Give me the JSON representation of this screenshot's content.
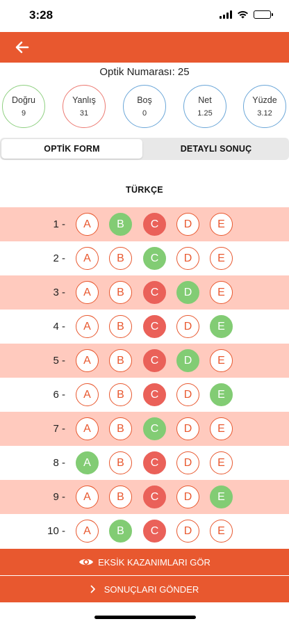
{
  "status_bar": {
    "time": "3:28"
  },
  "header": {
    "back_icon": "arrow-left-icon"
  },
  "optik": {
    "label": "Optik Numarası: 25"
  },
  "stats": [
    {
      "key": "dogru",
      "label": "Doğru",
      "value": "9",
      "color": "#8fd081"
    },
    {
      "key": "yanlis",
      "label": "Yanlış",
      "value": "31",
      "color": "#ec7a72"
    },
    {
      "key": "bos",
      "label": "Boş",
      "value": "0",
      "color": "#6aa6d8"
    },
    {
      "key": "net",
      "label": "Net",
      "value": "1.25",
      "color": "#6aa6d8"
    },
    {
      "key": "yuzde",
      "label": "Yüzde",
      "value": "3.12",
      "color": "#6aa6d8"
    }
  ],
  "tabs": {
    "optik_form": "OPTİK FORM",
    "detayli_sonuc": "DETAYLI SONUÇ",
    "active": "optik_form"
  },
  "section": {
    "title": "TÜRKÇE"
  },
  "options": [
    "A",
    "B",
    "C",
    "D",
    "E"
  ],
  "questions": [
    {
      "label": "1 -",
      "correct": "B",
      "marked": "C"
    },
    {
      "label": "2 -",
      "correct": "C",
      "marked": ""
    },
    {
      "label": "3 -",
      "correct": "D",
      "marked": "C"
    },
    {
      "label": "4 -",
      "correct": "E",
      "marked": "C"
    },
    {
      "label": "5 -",
      "correct": "D",
      "marked": "C"
    },
    {
      "label": "6 -",
      "correct": "E",
      "marked": "C"
    },
    {
      "label": "7 -",
      "correct": "C",
      "marked": ""
    },
    {
      "label": "8 -",
      "correct": "A",
      "marked": "C"
    },
    {
      "label": "9 -",
      "correct": "E",
      "marked": "C"
    },
    {
      "label": "10 -",
      "correct": "B",
      "marked": "C"
    }
  ],
  "buttons": {
    "eksik": {
      "label": "EKSİK KAZANIMLARI GÖR",
      "icon": "eye-icon"
    },
    "gonder": {
      "label": "SONUÇLARI GÖNDER",
      "icon": "chevron-right-icon"
    }
  },
  "colors": {
    "accent": "#e8582f",
    "row_highlight": "#ffcabe",
    "correct": "#82cc74",
    "wrong": "#ea6159"
  }
}
